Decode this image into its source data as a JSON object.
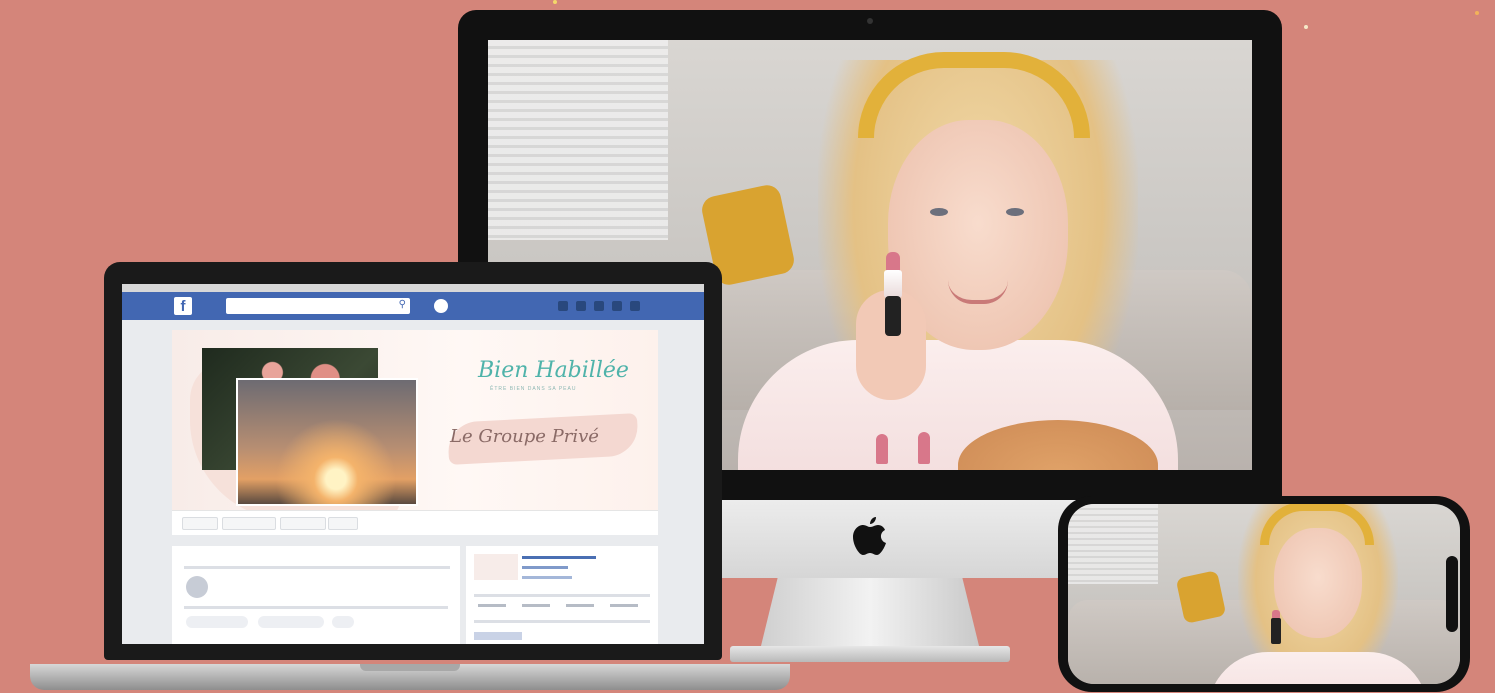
{
  "colors": {
    "background": "#d4857a",
    "facebook_blue": "#4267b2",
    "brand_teal": "#4fb3aa",
    "headband_yellow": "#e2b13a"
  },
  "imac": {
    "logo_icon": "apple-icon"
  },
  "facebook_page": {
    "logo_icon": "facebook-icon",
    "search_icon": "search-icon",
    "cover": {
      "brand_name": "Bien Habillée",
      "tagline": "ÊTRE BIEN DANS SA PEAU",
      "group_title": "Le Groupe Privé"
    }
  }
}
